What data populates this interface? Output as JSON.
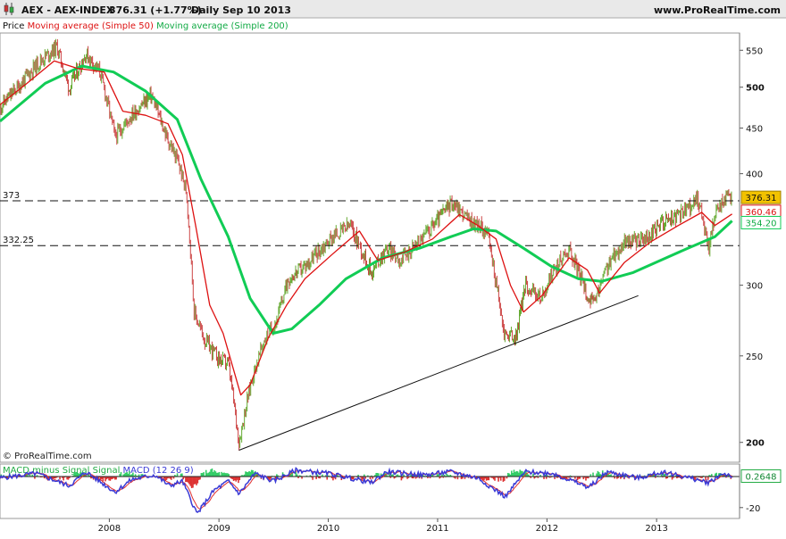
{
  "header": {
    "symbol": "AEX",
    "name": "AEX-INDEX",
    "price": "376.31",
    "change": "(+1.77%)",
    "interval": "Daily",
    "date": "Sep 10 2013",
    "site": "www.ProRealTime.com"
  },
  "legend": {
    "price": "Price",
    "ma50": "Moving average (Simple 50)",
    "ma200": "Moving average (Simple 200)"
  },
  "copyright": "© ProRealTime.com",
  "colors": {
    "ma50": "#dd1111",
    "ma200": "#11cc55",
    "candle_up": "#66aa33",
    "candle_down": "#cc4444",
    "macd": "#3a3ad6",
    "signal": "#e03030",
    "hist_pos": "#33cc66",
    "hist_neg": "#dd3333",
    "label_last": "#f2c200"
  },
  "chart_data": [
    {
      "type": "line",
      "title": "AEX - AEX-INDEX Daily",
      "y_scale": "log",
      "ylim": [
        190,
        575
      ],
      "yticks": [
        "550",
        "500",
        "450",
        "400",
        "300",
        "250",
        "200"
      ],
      "x_labels": [
        "2008",
        "2009",
        "2010",
        "2011",
        "2012",
        "2013"
      ],
      "x_domain": [
        "2007-01-01",
        "2013-10-05"
      ],
      "series": [
        {
          "name": "Price",
          "points": [
            [
              "2007-01-01",
              475
            ],
            [
              "2007-03-01",
              500
            ],
            [
              "2007-05-15",
              535
            ],
            [
              "2007-07-10",
              555
            ],
            [
              "2007-08-20",
              498
            ],
            [
              "2007-10-15",
              545
            ],
            [
              "2007-12-01",
              520
            ],
            [
              "2008-01-20",
              440
            ],
            [
              "2008-03-15",
              465
            ],
            [
              "2008-05-20",
              490
            ],
            [
              "2008-07-10",
              440
            ],
            [
              "2008-08-20",
              410
            ],
            [
              "2008-09-15",
              380
            ],
            [
              "2008-10-10",
              280
            ],
            [
              "2008-11-15",
              260
            ],
            [
              "2008-12-31",
              248
            ],
            [
              "2009-02-01",
              245
            ],
            [
              "2009-03-09",
              200
            ],
            [
              "2009-04-20",
              235
            ],
            [
              "2009-06-01",
              260
            ],
            [
              "2009-07-15",
              275
            ],
            [
              "2009-08-20",
              305
            ],
            [
              "2009-10-15",
              315
            ],
            [
              "2010-01-15",
              340
            ],
            [
              "2010-03-15",
              350
            ],
            [
              "2010-05-25",
              310
            ],
            [
              "2010-07-15",
              330
            ],
            [
              "2010-09-01",
              320
            ],
            [
              "2010-11-15",
              340
            ],
            [
              "2011-01-20",
              362
            ],
            [
              "2011-02-20",
              372
            ],
            [
              "2011-04-15",
              355
            ],
            [
              "2011-06-15",
              345
            ],
            [
              "2011-08-10",
              265
            ],
            [
              "2011-09-20",
              262
            ],
            [
              "2011-10-20",
              300
            ],
            [
              "2011-12-15",
              290
            ],
            [
              "2012-01-20",
              310
            ],
            [
              "2012-03-15",
              330
            ],
            [
              "2012-05-15",
              292
            ],
            [
              "2012-06-05",
              285
            ],
            [
              "2012-07-20",
              315
            ],
            [
              "2012-09-15",
              335
            ],
            [
              "2012-12-01",
              338
            ],
            [
              "2013-01-25",
              355
            ],
            [
              "2013-03-15",
              358
            ],
            [
              "2013-05-20",
              375
            ],
            [
              "2013-06-24",
              330
            ],
            [
              "2013-07-15",
              360
            ],
            [
              "2013-08-15",
              375
            ],
            [
              "2013-09-10",
              376.31
            ]
          ]
        },
        {
          "name": "Moving average (Simple 50)",
          "points": [
            [
              "2007-01-01",
              478
            ],
            [
              "2007-04-01",
              505
            ],
            [
              "2007-07-01",
              535
            ],
            [
              "2007-09-15",
              525
            ],
            [
              "2007-12-15",
              520
            ],
            [
              "2008-02-15",
              470
            ],
            [
              "2008-05-01",
              465
            ],
            [
              "2008-07-15",
              455
            ],
            [
              "2008-09-01",
              420
            ],
            [
              "2008-10-15",
              350
            ],
            [
              "2008-12-01",
              285
            ],
            [
              "2009-01-15",
              265
            ],
            [
              "2009-03-15",
              226
            ],
            [
              "2009-04-15",
              232
            ],
            [
              "2009-06-15",
              262
            ],
            [
              "2009-08-15",
              285
            ],
            [
              "2009-10-15",
              305
            ],
            [
              "2010-01-15",
              325
            ],
            [
              "2010-04-15",
              345
            ],
            [
              "2010-06-15",
              320
            ],
            [
              "2010-09-15",
              327
            ],
            [
              "2010-12-15",
              338
            ],
            [
              "2011-03-15",
              360
            ],
            [
              "2011-05-15",
              350
            ],
            [
              "2011-07-15",
              338
            ],
            [
              "2011-09-01",
              300
            ],
            [
              "2011-10-15",
              280
            ],
            [
              "2011-12-15",
              292
            ],
            [
              "2012-03-15",
              322
            ],
            [
              "2012-05-15",
              312
            ],
            [
              "2012-06-25",
              294
            ],
            [
              "2012-09-15",
              318
            ],
            [
              "2012-12-15",
              336
            ],
            [
              "2013-03-15",
              350
            ],
            [
              "2013-06-01",
              362
            ],
            [
              "2013-07-15",
              350
            ],
            [
              "2013-09-10",
              360.46
            ]
          ]
        },
        {
          "name": "Moving average (Simple 200)",
          "points": [
            [
              "2007-01-01",
              458
            ],
            [
              "2007-06-01",
              505
            ],
            [
              "2007-10-01",
              528
            ],
            [
              "2008-01-15",
              520
            ],
            [
              "2008-05-01",
              495
            ],
            [
              "2008-08-15",
              460
            ],
            [
              "2008-11-01",
              395
            ],
            [
              "2009-02-01",
              340
            ],
            [
              "2009-04-15",
              290
            ],
            [
              "2009-07-01",
              265
            ],
            [
              "2009-09-01",
              268
            ],
            [
              "2009-12-01",
              285
            ],
            [
              "2010-03-01",
              305
            ],
            [
              "2010-07-01",
              322
            ],
            [
              "2010-11-01",
              330
            ],
            [
              "2011-02-15",
              340
            ],
            [
              "2011-05-01",
              347
            ],
            [
              "2011-07-15",
              345
            ],
            [
              "2011-10-15",
              330
            ],
            [
              "2012-01-15",
              315
            ],
            [
              "2012-04-15",
              305
            ],
            [
              "2012-07-01",
              303
            ],
            [
              "2012-10-15",
              310
            ],
            [
              "2013-01-15",
              320
            ],
            [
              "2013-04-15",
              330
            ],
            [
              "2013-07-15",
              340
            ],
            [
              "2013-09-10",
              354.2
            ]
          ]
        }
      ],
      "horizontal_lines": [
        {
          "label": "373",
          "value": 373
        },
        {
          "label": "332.25",
          "value": 332.25
        }
      ],
      "trendline": [
        [
          "2009-03-09",
          196
        ],
        [
          "2012-11-01",
          292
        ]
      ],
      "last_values": {
        "price": "376.31",
        "ma50": "360.46",
        "ma200": "354.20"
      }
    },
    {
      "type": "line",
      "title": "MACD",
      "legend": [
        "MACD minus Signal Signal",
        "MACD (12 26 9)"
      ],
      "ylim": [
        -27,
        8
      ],
      "yticks": [
        "-20"
      ],
      "last_value": "0.2648",
      "series": [
        {
          "name": "MACD (12 26 9)",
          "points": [
            [
              "2007-01-01",
              -1
            ],
            [
              "2007-05-01",
              2
            ],
            [
              "2007-08-20",
              -6
            ],
            [
              "2007-10-15",
              3
            ],
            [
              "2008-01-20",
              -10
            ],
            [
              "2008-03-15",
              -2
            ],
            [
              "2008-06-01",
              1
            ],
            [
              "2008-07-20",
              -6
            ],
            [
              "2008-09-01",
              -3
            ],
            [
              "2008-10-20",
              -24
            ],
            [
              "2008-12-15",
              -9
            ],
            [
              "2009-02-01",
              -3
            ],
            [
              "2009-03-10",
              -11
            ],
            [
              "2009-05-01",
              2
            ],
            [
              "2009-07-01",
              -3
            ],
            [
              "2009-09-15",
              4
            ],
            [
              "2010-01-01",
              2
            ],
            [
              "2010-05-25",
              -4
            ],
            [
              "2010-07-15",
              3
            ],
            [
              "2010-11-15",
              1
            ],
            [
              "2011-02-15",
              3
            ],
            [
              "2011-05-15",
              -1
            ],
            [
              "2011-08-15",
              -13
            ],
            [
              "2011-10-20",
              3
            ],
            [
              "2012-01-20",
              2
            ],
            [
              "2012-05-20",
              -7
            ],
            [
              "2012-07-20",
              3
            ],
            [
              "2012-11-01",
              -1
            ],
            [
              "2013-01-25",
              3
            ],
            [
              "2013-06-24",
              -4
            ],
            [
              "2013-08-10",
              2
            ],
            [
              "2013-09-10",
              0.3
            ]
          ]
        }
      ]
    }
  ]
}
